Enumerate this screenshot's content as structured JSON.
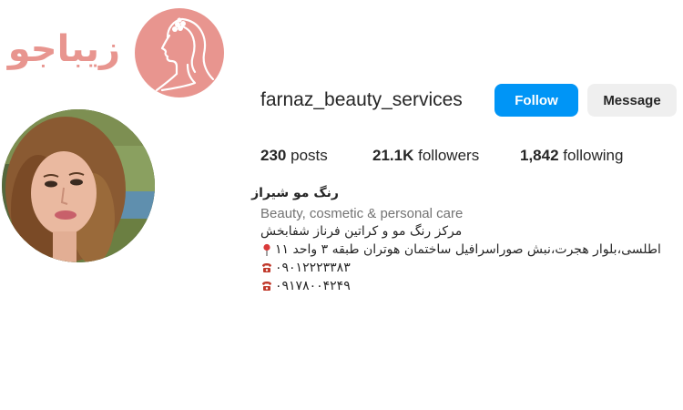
{
  "brand": {
    "logo_text": "زیباجو",
    "logo_icon": "woman-silhouette-icon",
    "accent": "#e8958f"
  },
  "profile": {
    "username": "farnaz_beauty_services",
    "follow_label": "Follow",
    "message_label": "Message",
    "follow_color": "#0095f6",
    "stats": {
      "posts_count": "230",
      "posts_label": "posts",
      "followers_count": "21.1K",
      "followers_label": "followers",
      "following_count": "1,842",
      "following_label": "following"
    },
    "bio": {
      "name": "رنگ مو شیراز",
      "category": "Beauty, cosmetic & personal care",
      "line1": "مرکز رنگ مو و کراتین فرناز شفابخش",
      "line2": "اطلسی،بلوار هجرت،نبش صوراسرافیل ساختمان هوتران طبقه ۳ واحد ۱۱",
      "line2_icon": "pin-icon",
      "phone1": "۰۹۰۱۲۲۲۳۳۸۳",
      "phone2": "۰۹۱۷۸۰۰۴۲۴۹",
      "phone_icon": "telephone-icon"
    }
  }
}
